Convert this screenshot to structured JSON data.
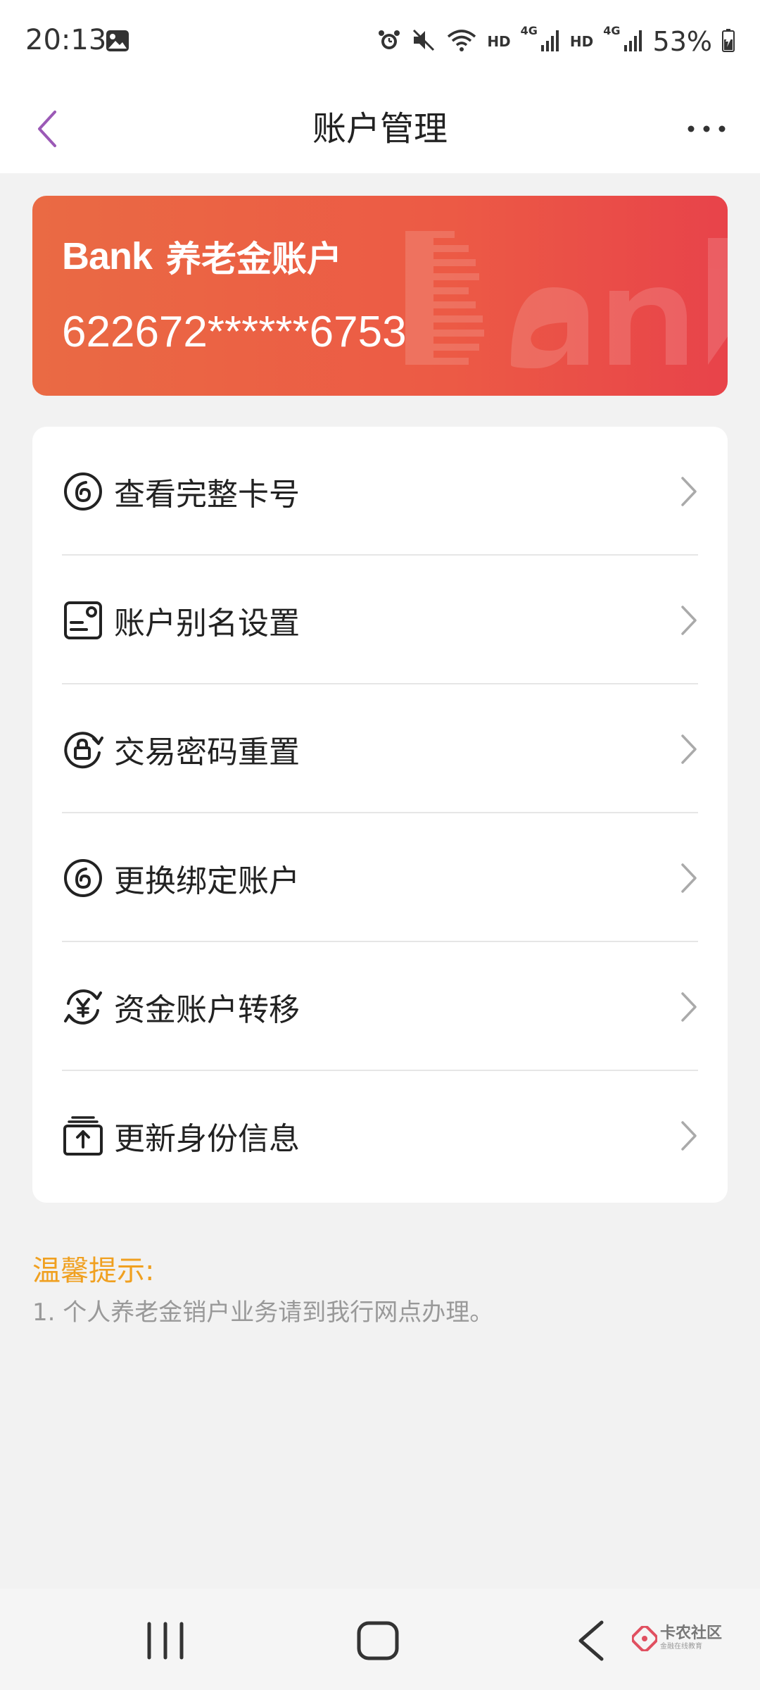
{
  "status_bar": {
    "time": "20:13",
    "hd1": "HD",
    "sig1_label": "4G",
    "hd2": "HD",
    "sig2_label": "4G",
    "battery": "53%",
    "icons": [
      "gallery-icon",
      "alarm-icon",
      "mute-icon",
      "wifi-icon",
      "signal-icon",
      "battery-icon"
    ]
  },
  "header": {
    "title": "账户管理",
    "back_icon": "chevron-left-icon",
    "more_icon": "more-dots-icon",
    "accent_color": "#9b59b6"
  },
  "card": {
    "logo": "Bank",
    "title": "养老金账户",
    "number": "622672******6753",
    "gradient": [
      "#ea6a44",
      "#e8434a"
    ]
  },
  "menu": {
    "items": [
      {
        "label": "查看完整卡号",
        "icon": "card-number-icon"
      },
      {
        "label": "账户别名设置",
        "icon": "alias-card-icon"
      },
      {
        "label": "交易密码重置",
        "icon": "lock-reset-icon"
      },
      {
        "label": "更换绑定账户",
        "icon": "bind-account-icon"
      },
      {
        "label": "资金账户转移",
        "icon": "yuan-transfer-icon"
      },
      {
        "label": "更新身份信息",
        "icon": "upload-id-icon"
      }
    ]
  },
  "tips": {
    "title": "温馨提示:",
    "line1": "1. 个人养老金销户业务请到我行网点办理。",
    "title_color": "#f0a020"
  },
  "nav_bar": {
    "icons": [
      "recents-icon",
      "home-icon",
      "back-icon"
    ],
    "watermark_name": "卡农社区",
    "watermark_sub": "金融在线教育"
  }
}
